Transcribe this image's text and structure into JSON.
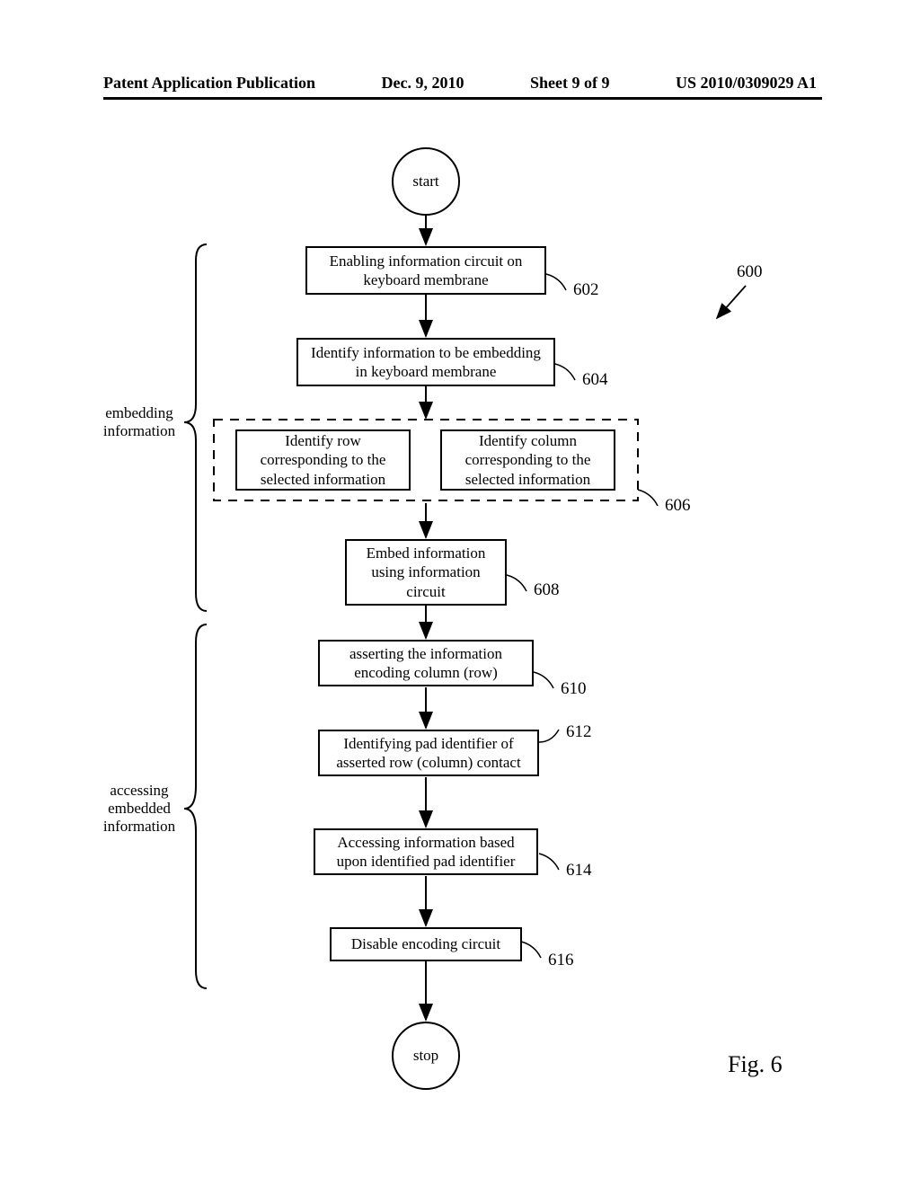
{
  "header": {
    "left": "Patent Application Publication",
    "center_date": "Dec. 9, 2010",
    "center_sheet": "Sheet 9 of 9",
    "right": "US 2010/0309029 A1"
  },
  "flowchart": {
    "start": "start",
    "stop": "stop",
    "steps": {
      "s602": "Enabling information circuit on keyboard membrane",
      "s604": "Identify information to be embedding in keyboard membrane",
      "s606a": "Identify row corresponding to the selected information",
      "s606b": "Identify column corresponding to the selected information",
      "s608": "Embed information using information circuit",
      "s610": "asserting the information encoding column (row)",
      "s612": "Identifying pad identifier of asserted row (column) contact",
      "s614": "Accessing information based upon identified pad identifier",
      "s616": "Disable encoding circuit"
    },
    "refs": {
      "r600": "600",
      "r602": "602",
      "r604": "604",
      "r606": "606",
      "r608": "608",
      "r610": "610",
      "r612": "612",
      "r614": "614",
      "r616": "616"
    },
    "side_labels": {
      "embedding": "embedding information",
      "accessing": "accessing embedded information"
    },
    "figure": "Fig. 6"
  },
  "chart_data": {
    "type": "flowchart",
    "title": "Fig. 6",
    "reference_number": 600,
    "nodes": [
      {
        "id": "start",
        "shape": "circle",
        "label": "start"
      },
      {
        "id": 602,
        "shape": "rect",
        "label": "Enabling information circuit on keyboard membrane"
      },
      {
        "id": 604,
        "shape": "rect",
        "label": "Identify information to be embedding in keyboard membrane"
      },
      {
        "id": 606,
        "shape": "dashed-group",
        "label": "",
        "children": [
          {
            "id": "606a",
            "shape": "rect",
            "label": "Identify row corresponding to the selected information"
          },
          {
            "id": "606b",
            "shape": "rect",
            "label": "Identify column corresponding to the selected information"
          }
        ]
      },
      {
        "id": 608,
        "shape": "rect",
        "label": "Embed information using information circuit"
      },
      {
        "id": 610,
        "shape": "rect",
        "label": "asserting the information encoding column (row)"
      },
      {
        "id": 612,
        "shape": "rect",
        "label": "Identifying pad identifier of asserted row (column) contact"
      },
      {
        "id": 614,
        "shape": "rect",
        "label": "Accessing information based upon identified pad identifier"
      },
      {
        "id": 616,
        "shape": "rect",
        "label": "Disable encoding circuit"
      },
      {
        "id": "stop",
        "shape": "circle",
        "label": "stop"
      }
    ],
    "edges": [
      [
        "start",
        602
      ],
      [
        602,
        604
      ],
      [
        604,
        606
      ],
      [
        606,
        608
      ],
      [
        608,
        610
      ],
      [
        610,
        612
      ],
      [
        612,
        614
      ],
      [
        614,
        616
      ],
      [
        616,
        "stop"
      ]
    ],
    "phase_brackets": [
      {
        "label": "embedding information",
        "covers": [
          602,
          604,
          606,
          608
        ]
      },
      {
        "label": "accessing embedded information",
        "covers": [
          610,
          612,
          614,
          616
        ]
      }
    ]
  }
}
